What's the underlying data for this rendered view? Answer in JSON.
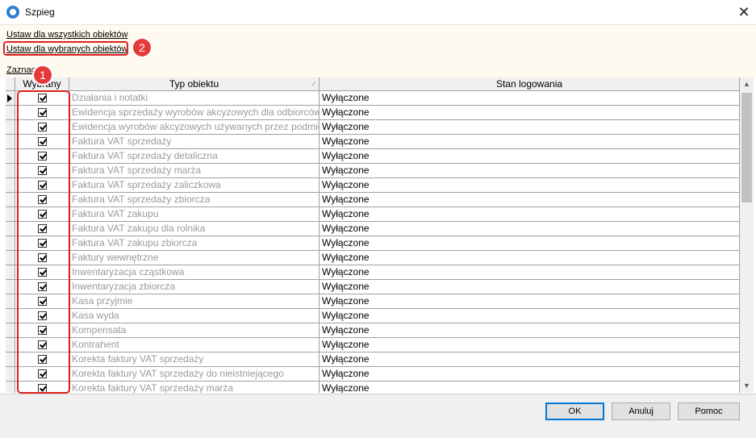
{
  "window": {
    "title": "Szpieg"
  },
  "links": {
    "set_all": "Ustaw dla wszystkich obiektów",
    "set_selected": "Ustaw dla wybranych obiektów",
    "select_all": "Zaznacz"
  },
  "badges": {
    "one": "1",
    "two": "2"
  },
  "grid": {
    "headers": {
      "selected": "Wybrany",
      "type": "Typ obiektu",
      "status": "Stan logowania"
    },
    "rows": [
      {
        "type": "Działania i notatki",
        "status": "Wyłączone"
      },
      {
        "type": "Ewidencja sprzedaży wyrobów akcyzowych dla odbiorców",
        "status": "Wyłączone"
      },
      {
        "type": "Ewidencja wyrobów akcyzowych używanych przez podmiot",
        "status": "Wyłączone"
      },
      {
        "type": "Faktura VAT sprzedaży",
        "status": "Wyłączone"
      },
      {
        "type": "Faktura VAT sprzedaży detaliczna",
        "status": "Wyłączone"
      },
      {
        "type": "Faktura VAT sprzedaży marża",
        "status": "Wyłączone"
      },
      {
        "type": "Faktura VAT sprzedaży zaliczkowa",
        "status": "Wyłączone"
      },
      {
        "type": "Faktura VAT sprzedaży zbiorcza",
        "status": "Wyłączone"
      },
      {
        "type": "Faktura VAT zakupu",
        "status": "Wyłączone"
      },
      {
        "type": "Faktura VAT zakupu dla rolnika",
        "status": "Wyłączone"
      },
      {
        "type": "Faktura VAT zakupu zbiorcza",
        "status": "Wyłączone"
      },
      {
        "type": "Faktury wewnętrzne",
        "status": "Wyłączone"
      },
      {
        "type": "Inwentaryzacja cząstkowa",
        "status": "Wyłączone"
      },
      {
        "type": "Inwentaryzacja zbiorcza",
        "status": "Wyłączone"
      },
      {
        "type": "Kasa przyjmie",
        "status": "Wyłączone"
      },
      {
        "type": "Kasa wyda",
        "status": "Wyłączone"
      },
      {
        "type": "Kompensata",
        "status": "Wyłączone"
      },
      {
        "type": "Kontrahent",
        "status": "Wyłączone"
      },
      {
        "type": "Korekta faktury VAT sprzedaży",
        "status": "Wyłączone"
      },
      {
        "type": "Korekta faktury VAT sprzedaży do nieistniejącego",
        "status": "Wyłączone"
      },
      {
        "type": "Korekta faktury VAT sprzedaży marża",
        "status": "Wyłączone"
      }
    ]
  },
  "buttons": {
    "ok": "OK",
    "cancel": "Anuluj",
    "help": "Pomoc"
  },
  "colors": {
    "highlight": "#e02020",
    "badge": "#e63a3a",
    "background": "#fffaf0"
  },
  "icons": {
    "close": "close-icon",
    "app": "spy-app-icon",
    "scroll_up": "chevron-up-icon",
    "scroll_down": "chevron-down-icon"
  }
}
